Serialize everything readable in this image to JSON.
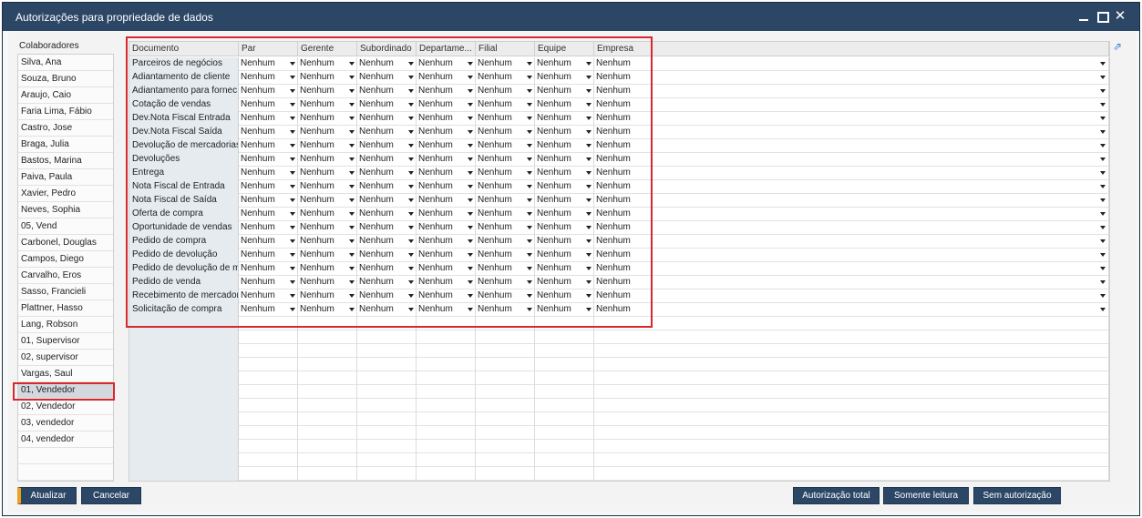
{
  "window": {
    "title": "Autorizações para propriedade de dados"
  },
  "colaboradores": {
    "title": "Colaboradores",
    "selected_index": 20,
    "items": [
      "Silva, Ana",
      "Souza, Bruno",
      "Araujo, Caio",
      "Faria Lima, Fábio",
      "Castro, Jose",
      "Braga, Julia",
      "Bastos, Marina",
      "Paiva, Paula",
      "Xavier, Pedro",
      "Neves, Sophia",
      "05, Vend",
      "Carbonel, Douglas",
      "Campos, Diego",
      "Carvalho, Eros",
      "Sasso, Francieli",
      "Plattner, Hasso",
      "Lang, Robson",
      "01, Supervisor",
      "02, supervisor",
      "Vargas, Saul",
      "01, Vendedor",
      "02, Vendedor",
      "03, vendedor",
      "04, vendedor"
    ]
  },
  "grid": {
    "columns": [
      "Documento",
      "Par",
      "Gerente",
      "Subordinado",
      "Departame...",
      "Filial",
      "Equipe",
      "Empresa"
    ],
    "default_value": "Nenhum",
    "rows": [
      "Parceiros de negócios",
      "Adiantamento de cliente",
      "Adiantamento para fornec",
      "Cotação de vendas",
      "Dev.Nota Fiscal Entrada",
      "Dev.Nota Fiscal Saída",
      "Devolução de mercadorias",
      "Devoluções",
      "Entrega",
      "Nota Fiscal de Entrada",
      "Nota Fiscal de Saída",
      "Oferta de compra",
      "Oportunidade de vendas",
      "Pedido de compra",
      "Pedido de devolução",
      "Pedido de devolução de m",
      "Pedido de venda",
      "Recebimento de mercador",
      "Solicitação de compra"
    ]
  },
  "buttons": {
    "atualizar": "Atualizar",
    "cancelar": "Cancelar",
    "autorizacao_total": "Autorização total",
    "somente_leitura": "Somente leitura",
    "sem_autorizacao": "Sem autorização"
  },
  "icons": {
    "expand": "expand-arrow-icon",
    "dropdown": "dropdown-arrow-icon",
    "minimize": "minimize-icon",
    "maximize": "maximize-icon",
    "close": "close-icon"
  },
  "colors": {
    "titlebar": "#2c4766",
    "button": "#2c4766",
    "accent": "#e9a321",
    "highlight": "#d7282f",
    "selected_row": "#d3d8df"
  }
}
